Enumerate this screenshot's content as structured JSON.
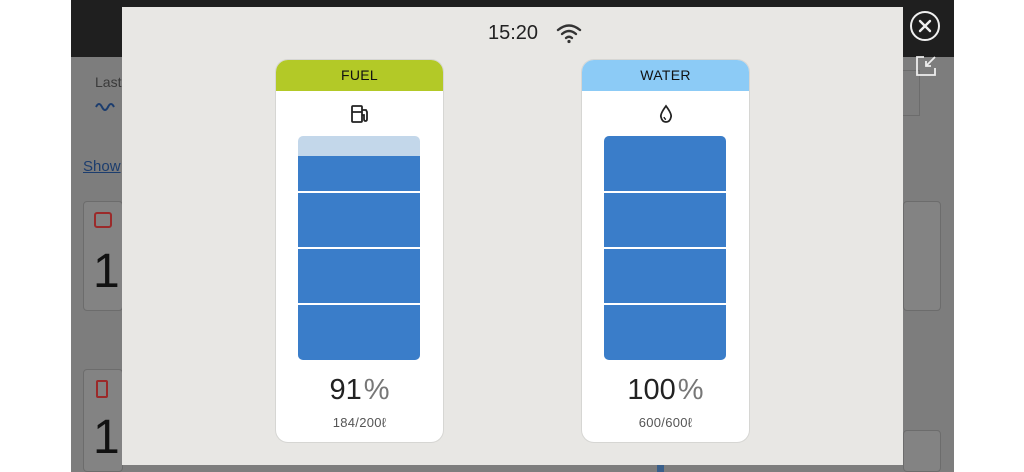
{
  "status_bar": {
    "time": "15:20",
    "wifi_icon": "wifi-icon"
  },
  "background": {
    "last_label": "Last",
    "show_link": "Show",
    "card1_value": "1",
    "card2_value": "1"
  },
  "tanks": [
    {
      "name": "FUEL",
      "icon": "fuel-pump-icon",
      "level_percent": 91,
      "percent_text": "91",
      "percent_sign": "%",
      "volume_text": "184/200ℓ",
      "header_color": "#b3c927"
    },
    {
      "name": "WATER",
      "icon": "water-drop-icon",
      "level_percent": 100,
      "percent_text": "100",
      "percent_sign": "%",
      "volume_text": "600/600ℓ",
      "header_color": "#8ccbf6"
    }
  ],
  "colors": {
    "fill": "#3a7dc9",
    "empty": "#c3d7ea",
    "modal_bg": "#e8e7e4"
  },
  "controls": {
    "close_icon": "close-icon",
    "popout_icon": "popout-icon"
  }
}
